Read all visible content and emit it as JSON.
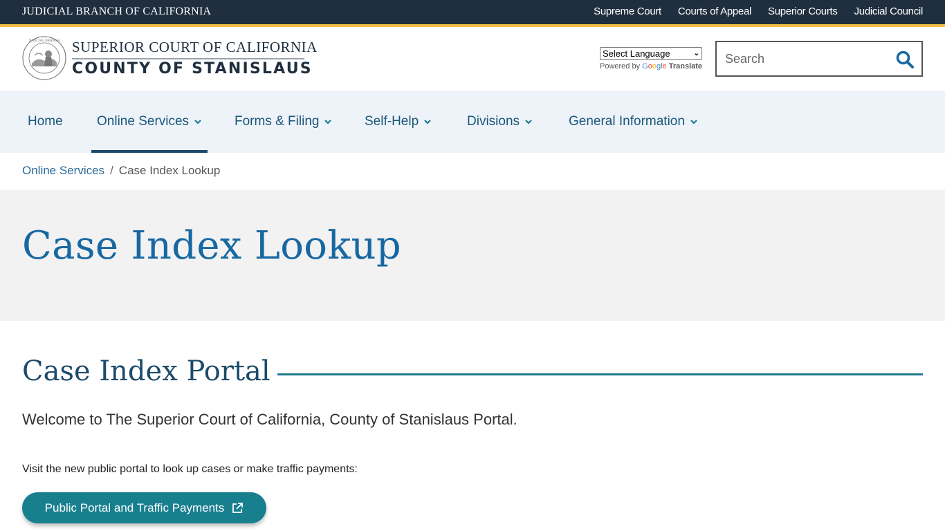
{
  "utility_bar": {
    "title": "JUDICIAL BRANCH OF CALIFORNIA",
    "links": [
      "Supreme Court",
      "Courts of Appeal",
      "Superior Courts",
      "Judicial Council"
    ]
  },
  "header": {
    "logo_line1": "SUPERIOR COURT OF CALIFORNIA",
    "logo_line2": "COUNTY OF STANISLAUS",
    "seal_icon": "judicial-branch-seal",
    "translate": {
      "select_label": "Select Language",
      "powered_by": "Powered by",
      "google": [
        "G",
        "o",
        "o",
        "g",
        "l",
        "e"
      ],
      "translate_word": "Translate"
    },
    "search": {
      "placeholder": "Search",
      "value": "",
      "icon": "search-icon"
    }
  },
  "nav": {
    "items": [
      {
        "label": "Home",
        "has_dropdown": false,
        "active": false
      },
      {
        "label": "Online Services",
        "has_dropdown": true,
        "active": true
      },
      {
        "label": "Forms & Filing",
        "has_dropdown": true,
        "active": false
      },
      {
        "label": "Self-Help",
        "has_dropdown": true,
        "active": false
      },
      {
        "label": "Divisions",
        "has_dropdown": true,
        "active": false
      },
      {
        "label": "General Information",
        "has_dropdown": true,
        "active": false
      }
    ]
  },
  "breadcrumb": {
    "parent": "Online Services",
    "separator": "/",
    "current": "Case Index Lookup"
  },
  "page": {
    "title": "Case Index Lookup",
    "section_title": "Case Index Portal",
    "welcome": "Welcome to The Superior Court of California, County of Stanislaus Portal.",
    "visit_text": "Visit the new public portal to look up cases or make traffic payments:",
    "portal_button": "Public Portal and Traffic Payments"
  },
  "colors": {
    "utility_bg": "#1f2f3f",
    "gold_accent": "#f0be46",
    "nav_bg": "#edf3f9",
    "nav_text": "#1a5678",
    "title_blue": "#1768a2",
    "teal": "#187f8f"
  }
}
